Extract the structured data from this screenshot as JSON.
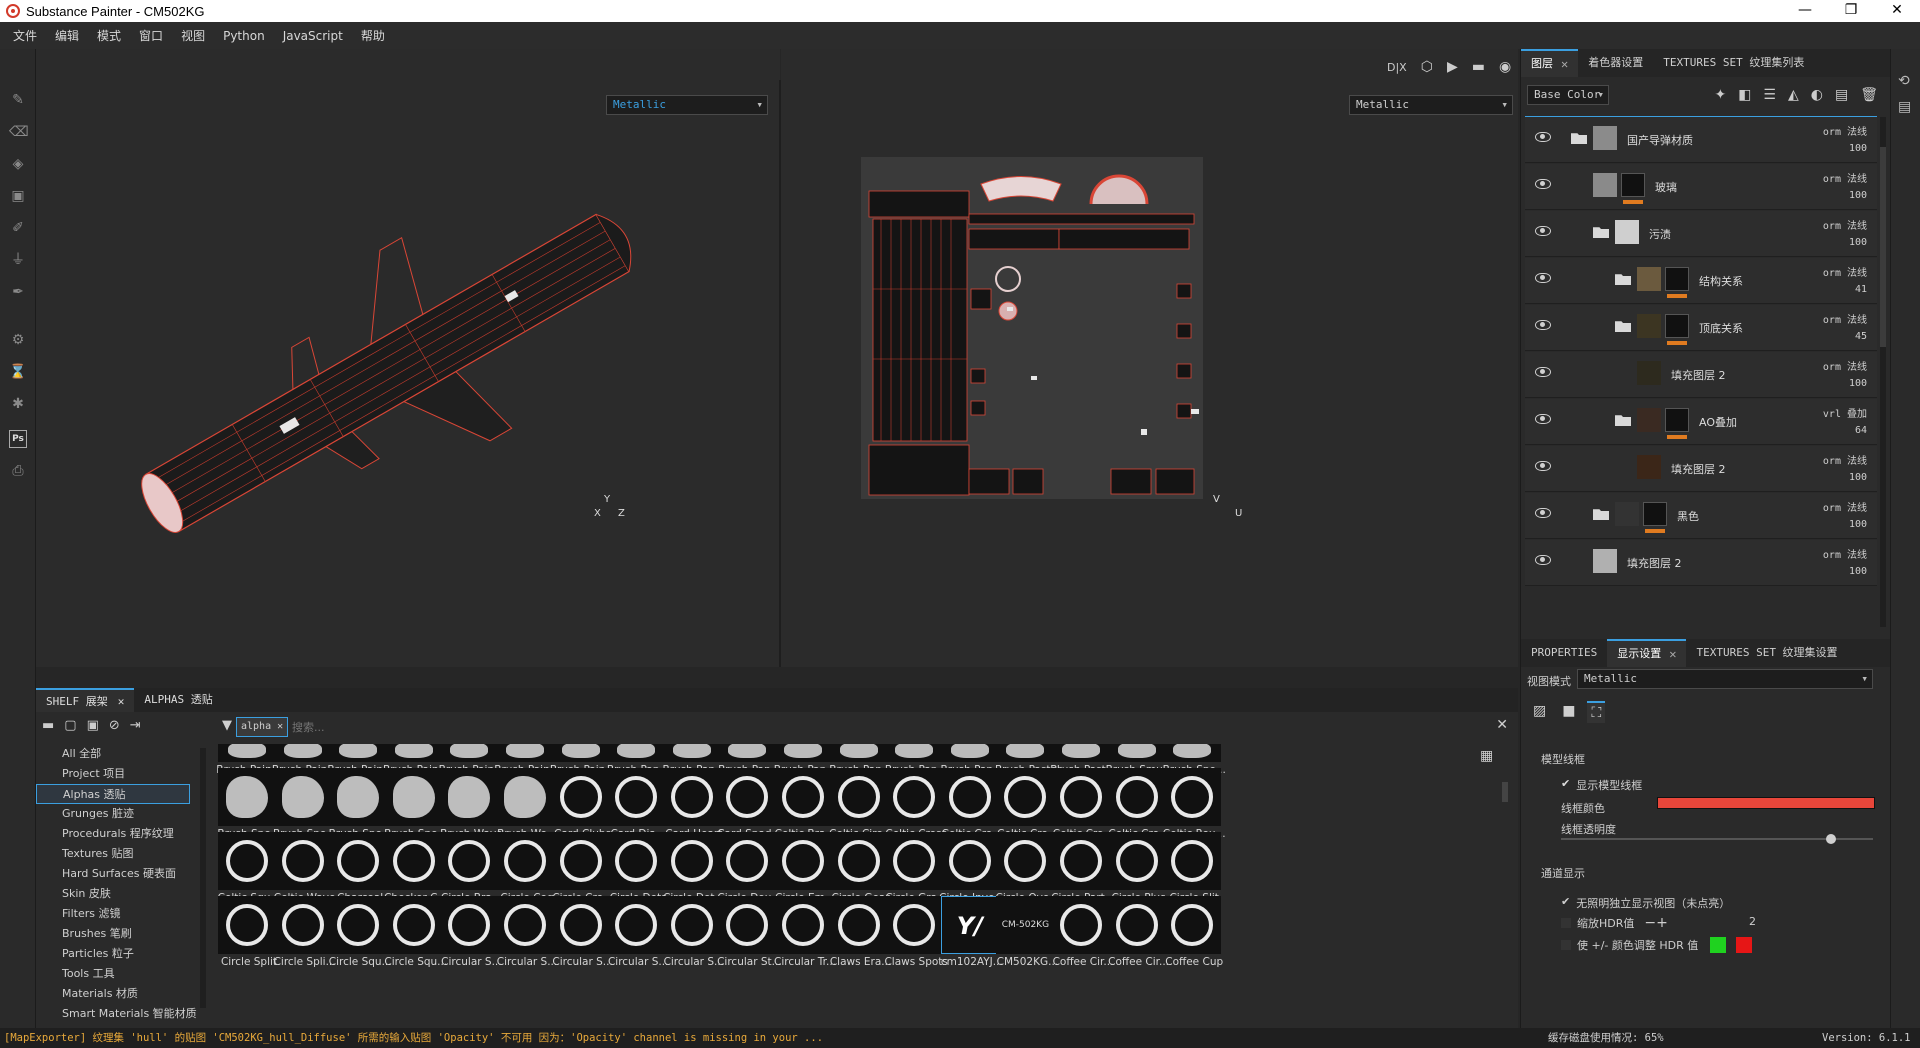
{
  "window": {
    "title": "Substance Painter - CM502KG",
    "controls": [
      "—",
      "❐",
      "✕"
    ]
  },
  "menu": [
    "文件",
    "编辑",
    "模式",
    "窗口",
    "视图",
    "Python",
    "JavaScript",
    "帮助"
  ],
  "viewport": {
    "left_channel": "Metallic",
    "right_channel": "Metallic",
    "toolbar_labels": [
      "D|X"
    ],
    "axes_3d": {
      "y": "Y",
      "x": "X",
      "z": "Z"
    },
    "axes_2d": {
      "v": "V",
      "u": "U"
    }
  },
  "layers_panel": {
    "tabs": [
      "图层",
      "着色器设置",
      "TEXTURES SET 纹理集列表"
    ],
    "channel_select": "Base Color",
    "layers": [
      {
        "name": "国产导弹材质",
        "blend": "orm 法线",
        "opacity": "100",
        "type": "folder",
        "indent": 1,
        "thumb": "#8b8b8b"
      },
      {
        "name": "玻璃",
        "blend": "orm 法线",
        "opacity": "100",
        "type": "fill-mask",
        "indent": 2,
        "thumb": "#8a8a8a"
      },
      {
        "name": "污渍",
        "blend": "orm 法线",
        "opacity": "100",
        "type": "folder",
        "indent": 2,
        "thumb": "#cfcfcf"
      },
      {
        "name": "结构关系",
        "blend": "orm 法线",
        "opacity": "41",
        "type": "folder-mask",
        "indent": 3,
        "thumb": "#6b5a3e"
      },
      {
        "name": "顶底关系",
        "blend": "orm 法线",
        "opacity": "45",
        "type": "folder-mask",
        "indent": 3,
        "thumb": "#3c3522"
      },
      {
        "name": "填充图层 2",
        "blend": "orm 法线",
        "opacity": "100",
        "type": "fill",
        "indent": 4,
        "thumb": "#2d2a1e"
      },
      {
        "name": "AO叠加",
        "blend": "vrl 叠加",
        "opacity": "64",
        "type": "folder-mask",
        "indent": 3,
        "thumb": "#3a2a22"
      },
      {
        "name": "填充图层 2",
        "blend": "orm 法线",
        "opacity": "100",
        "type": "fill",
        "indent": 4,
        "thumb": "#3b2618"
      },
      {
        "name": "黑色",
        "blend": "orm 法线",
        "opacity": "100",
        "type": "folder-mask",
        "indent": 2,
        "thumb": "#333333"
      },
      {
        "name": "填充图层 2",
        "blend": "orm 法线",
        "opacity": "100",
        "type": "fill",
        "indent": 2,
        "thumb": "#b0b0b0"
      }
    ]
  },
  "props_panel": {
    "tabs": [
      "PROPERTIES",
      "显示设置",
      "TEXTURES SET 纹理集设置"
    ],
    "view_mode_label": "视图模式",
    "view_mode_value": "Metallic",
    "section_wireframe": "模型线框",
    "show_wireframe": "显示模型线框",
    "wire_color_label": "线框颜色",
    "wire_color": "#e8463a",
    "wire_opacity_label": "线框透明度",
    "wire_opacity": 0.85,
    "section_channel": "通道显示",
    "channel_opt1": "无照明独立显示视图（未点亮）",
    "channel_opt2": "缩放HDR值",
    "hdr_value": "2",
    "channel_opt3": "使 +/- 颜色调整 HDR 值",
    "swatch_green": "#1fd21f",
    "swatch_red": "#e61616"
  },
  "shelf": {
    "tabs": [
      "SHELF 展架",
      "ALPHAS 透贴"
    ],
    "filter_tag": "alpha",
    "search_placeholder": "搜索...",
    "categories": [
      "All 全部",
      "Project 项目",
      "Alphas 透贴",
      "Grunges 脏迹",
      "Procedurals 程序纹理",
      "Textures 贴图",
      "Hard Surfaces 硬表面",
      "Skin 皮肤",
      "Filters 滤镜",
      "Brushes 笔刷",
      "Particles 粒子",
      "Tools 工具",
      "Materials 材质",
      "Smart Materials 智能材质"
    ],
    "active_category": "Alphas 透贴",
    "rows": [
      [
        "Brush Pain...",
        "Brush Pain...",
        "Brush Pain...",
        "Brush Pain...",
        "Brush Pain...",
        "Brush Pain...",
        "Brush Pain...",
        "Brush Pap...",
        "Brush Pap...",
        "Brush Pap...",
        "Brush Pap...",
        "Brush Pap...",
        "Brush Pap...",
        "Brush Pap...",
        "Brush Pastel",
        "Brush Past...",
        "Brush Smu...",
        "Brush Spo..."
      ],
      [
        "Brush Spo...",
        "Brush Spo...",
        "Brush Spo...",
        "Brush Spo...",
        "Brush Wave",
        "Brush Wo...",
        "Card Clubs",
        "Card Dia...",
        "Card Heart",
        "Card Spad...",
        "Celtic Bra...",
        "Celtic Circ...",
        "Celtic Cross",
        "Celtic Cro...",
        "Celtic Cro...",
        "Celtic Cro...",
        "Celtic Cro...",
        "Celtic Rou..."
      ],
      [
        "Celtic Squ...",
        "Celtic Wave",
        "Charcoal",
        "Checker C...",
        "Circle Bra...",
        "Circle Cog",
        "Circle Cro...",
        "Circle Dots",
        "Circle Dot...",
        "Circle Dou...",
        "Circle Em...",
        "Circle Gear",
        "Circle Gra...",
        "Circle Inve...",
        "Circle Ove...",
        "Circle Part...",
        "Circle Plus",
        "Circle Slit"
      ],
      [
        "Circle Split",
        "Circle Spli...",
        "Circle Squ...",
        "Circle Squ...",
        "Circular S...",
        "Circular S...",
        "Circular S...",
        "Circular S...",
        "Circular S...",
        "Circular St...",
        "Circular Tr...",
        "Claws Era...",
        "Claws Spots",
        "cm102AYJ...",
        "CM502KG...",
        "Coffee Cir...",
        "Coffee Cir...",
        "Coffee Cup"
      ]
    ],
    "thumb_texts": {
      "cm102": "Y/",
      "cm502": "CM-502KG"
    }
  },
  "status": {
    "message": "[MapExporter] 纹理集 'hull' 的贴图 'CM502KG_hull_Diffuse' 所需的输入贴图 'Opacity' 不可用 因为：'Opacity' channel is missing in your ...",
    "cache": "缓存磁盘使用情况:  65%",
    "version": "Version: 6.1.1"
  }
}
